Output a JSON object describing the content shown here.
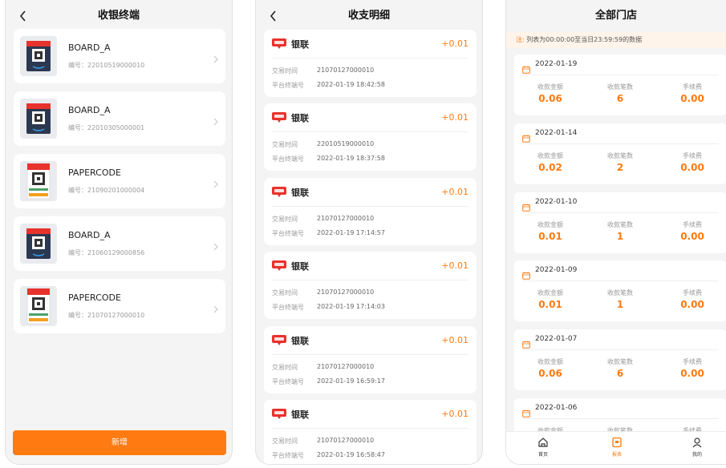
{
  "terminals_page": {
    "title": "收银终端",
    "add_label": "新增",
    "items": [
      {
        "name": "BOARD_A",
        "code": "编号：22010519000010",
        "type": "board"
      },
      {
        "name": "BOARD_A",
        "code": "编号：22010305000001",
        "type": "board"
      },
      {
        "name": "PAPERCODE",
        "code": "编号：21090201000004",
        "type": "paper"
      },
      {
        "name": "BOARD_A",
        "code": "编号：21060129000856",
        "type": "board"
      },
      {
        "name": "PAPERCODE",
        "code": "编号：21070127000010",
        "type": "paper"
      }
    ]
  },
  "transactions_page": {
    "title": "收支明细",
    "trade_time_label": "交易时间",
    "terminal_label": "平台终端号",
    "items": [
      {
        "channel": "银联",
        "amount": "+0.01",
        "trade_id": "21070127000010",
        "time": "2022-01-19 18:42:58"
      },
      {
        "channel": "银联",
        "amount": "+0.01",
        "trade_id": "22010519000010",
        "time": "2022-01-19 18:37:58"
      },
      {
        "channel": "银联",
        "amount": "+0.01",
        "trade_id": "21070127000010",
        "time": "2022-01-19 17:14:57"
      },
      {
        "channel": "银联",
        "amount": "+0.01",
        "trade_id": "21070127000010",
        "time": "2022-01-19 17:14:03"
      },
      {
        "channel": "银联",
        "amount": "+0.01",
        "trade_id": "21070127000010",
        "time": "2022-01-19 16:59:17"
      },
      {
        "channel": "银联",
        "amount": "+0.01",
        "trade_id": "21070127000010",
        "time": "2022-01-19 16:58:47"
      }
    ]
  },
  "stores_page": {
    "title": "全部门店",
    "note_key": "注:",
    "note_text": "列表为00:00:00至当日23:59:59的数据",
    "amount_label": "收款金额",
    "count_label": "收款笔数",
    "fee_label": "手续费",
    "days": [
      {
        "date": "2022-01-19",
        "amount": "0.06",
        "count": "6",
        "fee": "0.00"
      },
      {
        "date": "2022-01-14",
        "amount": "0.02",
        "count": "2",
        "fee": "0.00"
      },
      {
        "date": "2022-01-10",
        "amount": "0.01",
        "count": "1",
        "fee": "0.00"
      },
      {
        "date": "2022-01-09",
        "amount": "0.01",
        "count": "1",
        "fee": "0.00"
      },
      {
        "date": "2022-01-07",
        "amount": "0.06",
        "count": "6",
        "fee": "0.00"
      },
      {
        "date": "2022-01-06",
        "amount": "",
        "count": "",
        "fee": ""
      }
    ],
    "tabs": [
      {
        "label": "首页",
        "icon": "home-icon"
      },
      {
        "label": "报表",
        "icon": "report-icon"
      },
      {
        "label": "我的",
        "icon": "profile-icon"
      }
    ]
  },
  "colors": {
    "accent": "#ff7a10",
    "channel_red": "#e8322d",
    "card": "#ffffff",
    "bg": "#f4f4f4"
  }
}
